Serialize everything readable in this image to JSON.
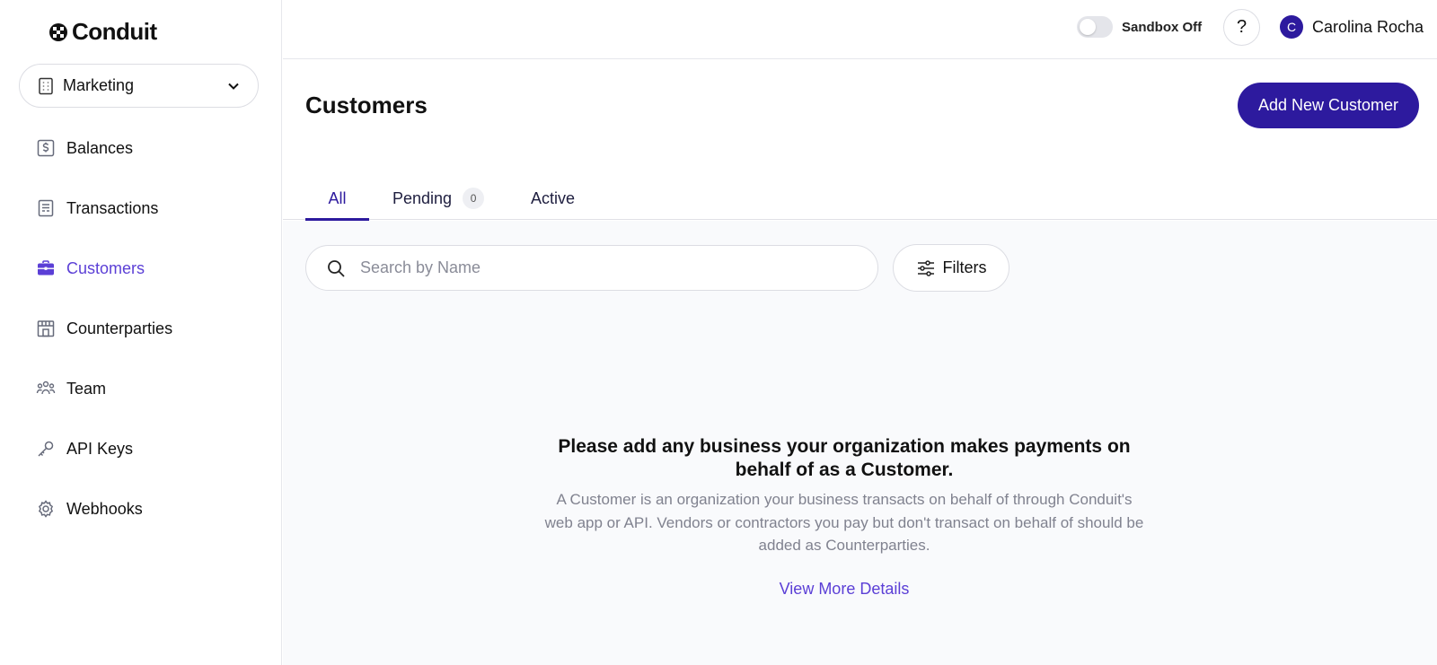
{
  "brand": {
    "name": "Conduit"
  },
  "workspace": {
    "label": "Marketing"
  },
  "sidebar": {
    "items": [
      {
        "label": "Balances",
        "icon": "dollar-icon",
        "active": false
      },
      {
        "label": "Transactions",
        "icon": "receipt-icon",
        "active": false
      },
      {
        "label": "Customers",
        "icon": "briefcase-icon",
        "active": true
      },
      {
        "label": "Counterparties",
        "icon": "storefront-icon",
        "active": false
      },
      {
        "label": "Team",
        "icon": "users-icon",
        "active": false
      },
      {
        "label": "API Keys",
        "icon": "key-icon",
        "active": false
      },
      {
        "label": "Webhooks",
        "icon": "gear-icon",
        "active": false
      }
    ]
  },
  "topbar": {
    "sandbox_label": "Sandbox Off",
    "help_label": "?",
    "user_initial": "C",
    "user_name": "Carolina Rocha"
  },
  "page": {
    "title": "Customers",
    "add_button": "Add New Customer"
  },
  "tabs": {
    "all": "All",
    "pending": "Pending",
    "pending_count": "0",
    "active": "Active"
  },
  "search": {
    "placeholder": "Search by Name",
    "value": ""
  },
  "filters": {
    "label": "Filters"
  },
  "empty_state": {
    "title": "Please add any business your organization makes payments on behalf of as a Customer.",
    "description": "A Customer is an organization your business transacts on behalf of through Conduit's web app or API. Vendors or contractors you pay but don't transact on behalf of should be added as Counterparties.",
    "link": "View More Details"
  },
  "colors": {
    "primary": "#2d1a9e",
    "accent": "#5b3fd6",
    "muted_text": "#80828f",
    "content_bg": "#f9fafc"
  }
}
